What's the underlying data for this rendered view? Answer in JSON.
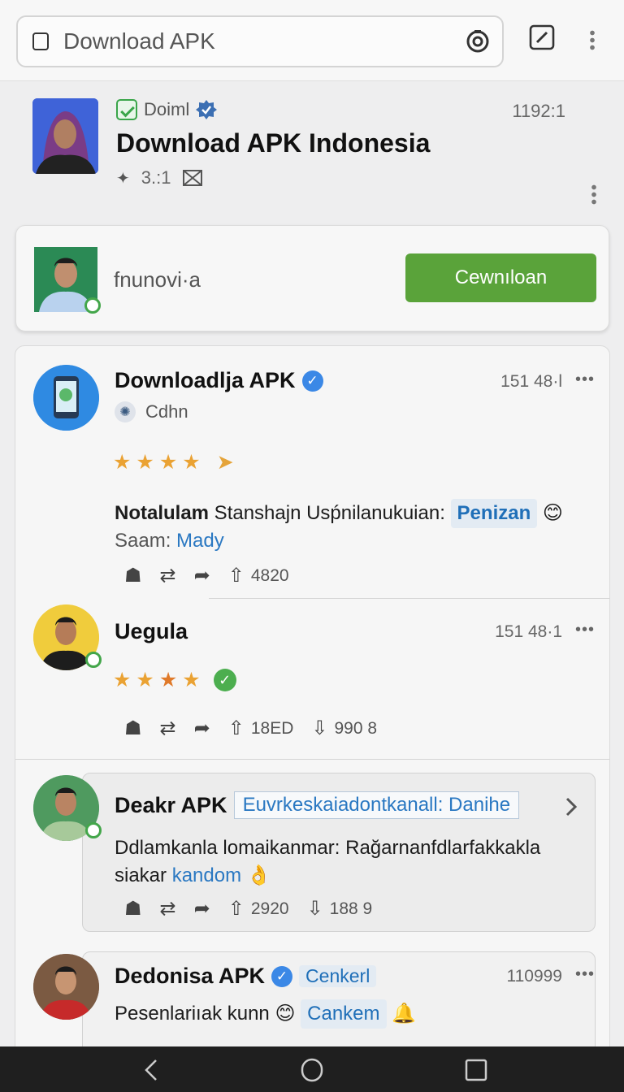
{
  "search": {
    "query": "Download APK"
  },
  "profile": {
    "source_label": "Doiml",
    "title": "Download APK Indonesia",
    "meta": "3.:1",
    "count": "1192:1"
  },
  "download_card": {
    "username": "fnunovi·a",
    "button_label": "Cewnıloan"
  },
  "posts": [
    {
      "name": "Downloadlja APK",
      "count": "151 48·l",
      "sub": "Cdhn",
      "body_bold": "Notalulam",
      "body_text": " Stanshajn Usṕnilanukuian: ",
      "chip": "Penizan",
      "line2_label": "Saam: ",
      "line2_link": "Mady",
      "stat": "4820"
    },
    {
      "name": "Uegula",
      "count": "151 48·1",
      "stat1": "18ED",
      "stat2": "990 8"
    },
    {
      "name": "Deakr APK",
      "tag": "Euvrkeskaiadontkanall: Danihe",
      "body": "Ddlamkanla lomaikanmar: Rağarnanfdlarfakkakla",
      "line2_label": "siakar ",
      "line2_link": "kandom",
      "stat1": "2920",
      "stat2": "188 9"
    },
    {
      "name": "Dedonisa APK",
      "chip": "Cenkerl",
      "count": "110999",
      "body": "Pesenlariıak kunn ",
      "link": "Cankem"
    }
  ],
  "kebab_symbol": "•••",
  "colors": {
    "accent_green": "#5aa33a",
    "link_blue": "#2a78c2",
    "verified_blue": "#3b88e6"
  }
}
